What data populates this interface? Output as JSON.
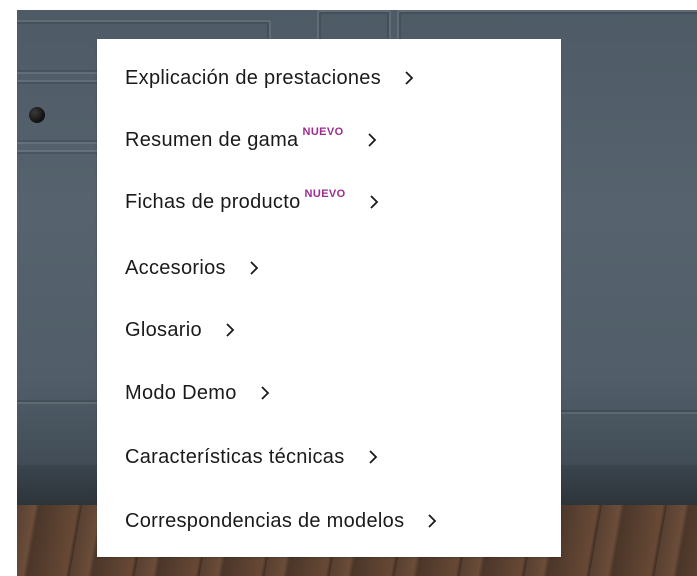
{
  "menu": {
    "items": [
      {
        "label": "Explicación de prestaciones",
        "badge": "",
        "icon": "chevron-right-icon"
      },
      {
        "label": "Resumen de gama",
        "badge": "NUEVO",
        "icon": "chevron-right-icon"
      },
      {
        "label": "Fichas de producto",
        "badge": "NUEVO",
        "icon": "chevron-right-icon"
      },
      {
        "label": "Accesorios",
        "badge": "",
        "icon": "chevron-right-icon"
      },
      {
        "label": "Glosario",
        "badge": "",
        "icon": "chevron-right-icon"
      },
      {
        "label": "Modo Demo",
        "badge": "",
        "icon": "chevron-right-icon"
      },
      {
        "label": "Características técnicas",
        "badge": "",
        "icon": "chevron-right-icon"
      },
      {
        "label": "Correspondencias de modelos",
        "badge": "",
        "icon": "chevron-right-icon"
      }
    ],
    "badge_color": "#9b2d8e",
    "text_color": "#1a1a1a"
  }
}
